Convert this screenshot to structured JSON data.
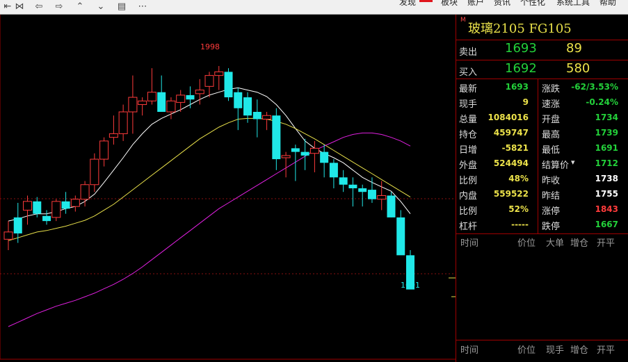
{
  "toolbar": {
    "icons": [
      "nav-first-icon",
      "nav-back-icon",
      "nav-forward-icon",
      "zoom-in-icon",
      "zoom-out-icon",
      "notes-icon",
      "more-icon"
    ],
    "menus": [
      "发现",
      "板块",
      "账户",
      "资讯",
      "个性化",
      "系统工具",
      "帮助"
    ],
    "accent_color": "#e0161d"
  },
  "chart": {
    "high_label": "1998",
    "low_label": "1691",
    "up_color": "#ff3b3b",
    "down_color": "#20e8e8",
    "ma_colors": [
      "#ffffff",
      "#e8e04a",
      "#e020e0"
    ]
  },
  "chart_data": {
    "type": "candlestick",
    "title": "",
    "ylim": [
      1620,
      2040
    ],
    "candles": [
      [
        1760,
        1785,
        1745,
        1770
      ],
      [
        1790,
        1810,
        1755,
        1768
      ],
      [
        1800,
        1820,
        1780,
        1812
      ],
      [
        1812,
        1818,
        1790,
        1795
      ],
      [
        1792,
        1800,
        1780,
        1785
      ],
      [
        1790,
        1815,
        1785,
        1812
      ],
      [
        1812,
        1825,
        1795,
        1802
      ],
      [
        1805,
        1820,
        1798,
        1815
      ],
      [
        1815,
        1840,
        1805,
        1835
      ],
      [
        1835,
        1878,
        1825,
        1870
      ],
      [
        1870,
        1900,
        1860,
        1895
      ],
      [
        1900,
        1930,
        1890,
        1905
      ],
      [
        1905,
        1945,
        1895,
        1935
      ],
      [
        1935,
        1985,
        1905,
        1955
      ],
      [
        1945,
        1955,
        1930,
        1950
      ],
      [
        1950,
        1995,
        1945,
        1962
      ],
      [
        1962,
        1985,
        1940,
        1935
      ],
      [
        1935,
        1955,
        1925,
        1950
      ],
      [
        1948,
        1965,
        1935,
        1958
      ],
      [
        1958,
        1970,
        1940,
        1952
      ],
      [
        1960,
        1980,
        1945,
        1965
      ],
      [
        1970,
        1990,
        1955,
        1985
      ],
      [
        1985,
        1998,
        1965,
        1990
      ],
      [
        1990,
        1995,
        1950,
        1955
      ],
      [
        1962,
        1968,
        1910,
        1940
      ],
      [
        1955,
        1962,
        1920,
        1930
      ],
      [
        1935,
        1952,
        1900,
        1925
      ],
      [
        1925,
        1935,
        1910,
        1930
      ],
      [
        1930,
        1940,
        1855,
        1870
      ],
      [
        1872,
        1880,
        1845,
        1875
      ],
      [
        1885,
        1890,
        1840,
        1880
      ],
      [
        1880,
        1898,
        1855,
        1875
      ],
      [
        1878,
        1895,
        1852,
        1885
      ],
      [
        1880,
        1890,
        1845,
        1865
      ],
      [
        1865,
        1870,
        1830,
        1845
      ],
      [
        1845,
        1855,
        1825,
        1835
      ],
      [
        1835,
        1845,
        1805,
        1830
      ],
      [
        1830,
        1835,
        1805,
        1825
      ],
      [
        1828,
        1845,
        1810,
        1815
      ],
      [
        1815,
        1840,
        1800,
        1820
      ],
      [
        1820,
        1825,
        1790,
        1790
      ],
      [
        1790,
        1800,
        1745,
        1738
      ],
      [
        1738,
        1745,
        1700,
        1691
      ]
    ],
    "ma_fast": [
      1785,
      1788,
      1792,
      1795,
      1795,
      1798,
      1802,
      1805,
      1812,
      1822,
      1838,
      1855,
      1872,
      1890,
      1905,
      1918,
      1926,
      1932,
      1938,
      1945,
      1952,
      1958,
      1962,
      1966,
      1968,
      1965,
      1962,
      1956,
      1945,
      1930,
      1912,
      1895,
      1885,
      1878,
      1872,
      1865,
      1855,
      1845,
      1838,
      1832,
      1826,
      1812,
      1795
    ],
    "ma_slow": [
      1758,
      1762,
      1766,
      1770,
      1772,
      1775,
      1778,
      1782,
      1786,
      1792,
      1800,
      1808,
      1818,
      1828,
      1838,
      1848,
      1858,
      1868,
      1878,
      1888,
      1898,
      1906,
      1914,
      1920,
      1925,
      1926,
      1926,
      1925,
      1922,
      1918,
      1912,
      1905,
      1898,
      1890,
      1882,
      1874,
      1866,
      1858,
      1850,
      1842,
      1834,
      1826,
      1818
    ],
    "ma_long": [
      1640,
      1646,
      1652,
      1658,
      1663,
      1668,
      1672,
      1676,
      1681,
      1686,
      1692,
      1698,
      1705,
      1713,
      1722,
      1732,
      1742,
      1752,
      1762,
      1772,
      1782,
      1792,
      1802,
      1810,
      1818,
      1826,
      1834,
      1842,
      1850,
      1858,
      1866,
      1874,
      1882,
      1888,
      1894,
      1900,
      1904,
      1906,
      1906,
      1904,
      1900,
      1895,
      1888
    ]
  },
  "panel": {
    "title_prefix": "M",
    "title": "玻璃2105 FG105",
    "sell": {
      "label": "卖出",
      "price": "1693",
      "vol": "89"
    },
    "buy": {
      "label": "买入",
      "price": "1692",
      "vol": "580"
    },
    "stats_left": [
      {
        "k": "最新",
        "v": "1693",
        "c": "#23d13a"
      },
      {
        "k": "现手",
        "v": "9",
        "c": "#ece24a"
      },
      {
        "k": "总量",
        "v": "1084016",
        "c": "#ece24a"
      },
      {
        "k": "持仓",
        "v": "459747",
        "c": "#ece24a"
      },
      {
        "k": "日增",
        "v": "-5821",
        "c": "#ece24a"
      },
      {
        "k": "外盘",
        "v": "524494",
        "c": "#ece24a"
      },
      {
        "k": "比例",
        "v": "48%",
        "c": "#ece24a"
      },
      {
        "k": "内盘",
        "v": "559522",
        "c": "#ece24a"
      },
      {
        "k": "比例",
        "v": "52%",
        "c": "#ece24a"
      },
      {
        "k": "杠杆",
        "v": "-----",
        "c": "#ece24a"
      }
    ],
    "stats_right": [
      {
        "k": "涨跌",
        "v": "-62/3.53%",
        "c": "#23d13a"
      },
      {
        "k": "速涨",
        "v": "-0.24%",
        "c": "#23d13a"
      },
      {
        "k": "开盘",
        "v": "1734",
        "c": "#23d13a"
      },
      {
        "k": "最高",
        "v": "1739",
        "c": "#23d13a"
      },
      {
        "k": "最低",
        "v": "1691",
        "c": "#23d13a"
      },
      {
        "k": "结算价",
        "v": "1712",
        "c": "#23d13a"
      },
      {
        "k": "昨收",
        "v": "1738",
        "c": "#ffffff"
      },
      {
        "k": "昨结",
        "v": "1755",
        "c": "#ffffff"
      },
      {
        "k": "涨停",
        "v": "1843",
        "c": "#ff3b3b"
      },
      {
        "k": "跌停",
        "v": "1667",
        "c": "#23d13a"
      }
    ],
    "tick_header": [
      "时间",
      "价位",
      "大单",
      "增仓",
      "开平"
    ],
    "trade_header": [
      "时间",
      "价位",
      "现手",
      "增仓",
      "开平"
    ]
  }
}
